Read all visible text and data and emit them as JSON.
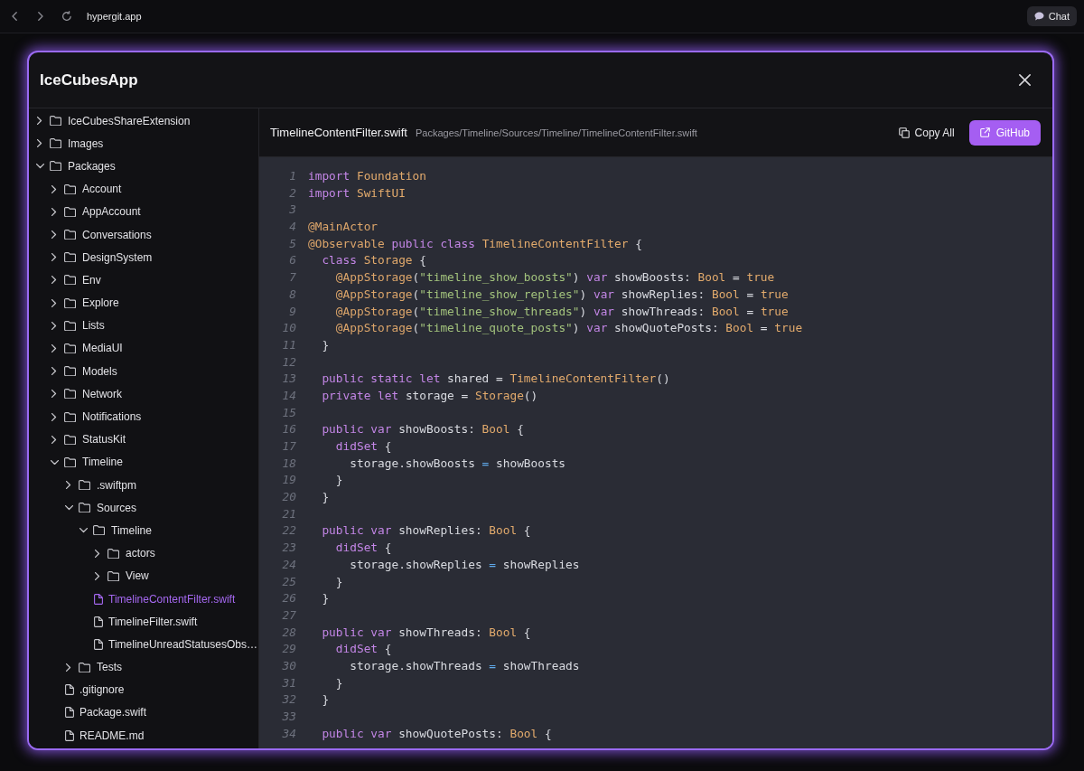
{
  "browser": {
    "url": "hypergit.app",
    "chat_button": "Chat"
  },
  "modal": {
    "title": "IceCubesApp"
  },
  "file_tree": [
    {
      "label": "IceCubesShareExtension",
      "kind": "folder",
      "expanded": false,
      "selected": false
    },
    {
      "label": "Images",
      "kind": "folder",
      "expanded": false,
      "selected": false
    },
    {
      "label": "Packages",
      "kind": "folder",
      "expanded": true,
      "selected": false,
      "children": [
        {
          "label": "Account",
          "kind": "folder",
          "expanded": false,
          "selected": false
        },
        {
          "label": "AppAccount",
          "kind": "folder",
          "expanded": false,
          "selected": false
        },
        {
          "label": "Conversations",
          "kind": "folder",
          "expanded": false,
          "selected": false
        },
        {
          "label": "DesignSystem",
          "kind": "folder",
          "expanded": false,
          "selected": false
        },
        {
          "label": "Env",
          "kind": "folder",
          "expanded": false,
          "selected": false
        },
        {
          "label": "Explore",
          "kind": "folder",
          "expanded": false,
          "selected": false
        },
        {
          "label": "Lists",
          "kind": "folder",
          "expanded": false,
          "selected": false
        },
        {
          "label": "MediaUI",
          "kind": "folder",
          "expanded": false,
          "selected": false
        },
        {
          "label": "Models",
          "kind": "folder",
          "expanded": false,
          "selected": false
        },
        {
          "label": "Network",
          "kind": "folder",
          "expanded": false,
          "selected": false
        },
        {
          "label": "Notifications",
          "kind": "folder",
          "expanded": false,
          "selected": false
        },
        {
          "label": "StatusKit",
          "kind": "folder",
          "expanded": false,
          "selected": false
        },
        {
          "label": "Timeline",
          "kind": "folder",
          "expanded": true,
          "selected": false,
          "children": [
            {
              "label": ".swiftpm",
              "kind": "folder",
              "expanded": false,
              "selected": false
            },
            {
              "label": "Sources",
              "kind": "folder",
              "expanded": true,
              "selected": false,
              "children": [
                {
                  "label": "Timeline",
                  "kind": "folder",
                  "expanded": true,
                  "selected": false,
                  "children": [
                    {
                      "label": "actors",
                      "kind": "folder",
                      "expanded": false,
                      "selected": false
                    },
                    {
                      "label": "View",
                      "kind": "folder",
                      "expanded": false,
                      "selected": false
                    },
                    {
                      "label": "TimelineContentFilter.swift",
                      "kind": "file",
                      "selected": true
                    },
                    {
                      "label": "TimelineFilter.swift",
                      "kind": "file",
                      "selected": false
                    },
                    {
                      "label": "TimelineUnreadStatusesObs…",
                      "kind": "file",
                      "selected": false
                    }
                  ]
                }
              ]
            },
            {
              "label": "Tests",
              "kind": "folder",
              "expanded": false,
              "selected": false
            },
            {
              "label": ".gitignore",
              "kind": "file",
              "selected": false
            },
            {
              "label": "Package.swift",
              "kind": "file",
              "selected": false
            },
            {
              "label": "README.md",
              "kind": "file",
              "selected": false
            }
          ]
        }
      ]
    }
  ],
  "file_header": {
    "name": "TimelineContentFilter.swift",
    "path": "Packages/Timeline/Sources/Timeline/TimelineContentFilter.swift",
    "copy_button": "Copy All",
    "github_button": "GitHub"
  },
  "code": {
    "lines": [
      {
        "number": "1",
        "tokens": [
          {
            "kind": "keyword",
            "text": "import"
          },
          {
            "kind": "type",
            "text": " Foundation"
          }
        ]
      },
      {
        "number": "2",
        "tokens": [
          {
            "kind": "keyword",
            "text": "import"
          },
          {
            "kind": "type",
            "text": " SwiftUI"
          }
        ]
      },
      {
        "number": "3"
      },
      {
        "number": "4",
        "tokens": [
          {
            "kind": "attribute",
            "text": "@MainActor"
          }
        ]
      },
      {
        "number": "5",
        "tokens": [
          {
            "kind": "attribute",
            "text": "@Observable"
          },
          {
            "kind": "keyword",
            "text": " public class"
          },
          {
            "kind": "type",
            "text": " TimelineContentFilter"
          },
          {
            "kind": "plain",
            "text": " {"
          }
        ]
      },
      {
        "number": "6",
        "tokens": [
          {
            "kind": "keyword",
            "text": "  class"
          },
          {
            "kind": "type",
            "text": " Storage"
          },
          {
            "kind": "plain",
            "text": " {"
          }
        ]
      },
      {
        "number": "7",
        "tokens": [
          {
            "kind": "attribute",
            "text": "    @AppStorage"
          },
          {
            "kind": "plain",
            "text": "("
          },
          {
            "kind": "string",
            "text": "\"timeline_show_boosts\""
          },
          {
            "kind": "plain",
            "text": ")"
          },
          {
            "kind": "keyword",
            "text": " var"
          },
          {
            "kind": "plain",
            "text": " showBoosts:"
          },
          {
            "kind": "type",
            "text": " Bool"
          },
          {
            "kind": "plain",
            "text": " ="
          },
          {
            "kind": "literal",
            "text": " true"
          }
        ]
      },
      {
        "number": "8",
        "tokens": [
          {
            "kind": "attribute",
            "text": "    @AppStorage"
          },
          {
            "kind": "plain",
            "text": "("
          },
          {
            "kind": "string",
            "text": "\"timeline_show_replies\""
          },
          {
            "kind": "plain",
            "text": ")"
          },
          {
            "kind": "keyword",
            "text": " var"
          },
          {
            "kind": "plain",
            "text": " showReplies:"
          },
          {
            "kind": "type",
            "text": " Bool"
          },
          {
            "kind": "plain",
            "text": " ="
          },
          {
            "kind": "literal",
            "text": " true"
          }
        ]
      },
      {
        "number": "9",
        "tokens": [
          {
            "kind": "attribute",
            "text": "    @AppStorage"
          },
          {
            "kind": "plain",
            "text": "("
          },
          {
            "kind": "string",
            "text": "\"timeline_show_threads\""
          },
          {
            "kind": "plain",
            "text": ")"
          },
          {
            "kind": "keyword",
            "text": " var"
          },
          {
            "kind": "plain",
            "text": " showThreads:"
          },
          {
            "kind": "type",
            "text": " Bool"
          },
          {
            "kind": "plain",
            "text": " ="
          },
          {
            "kind": "literal",
            "text": " true"
          }
        ]
      },
      {
        "number": "10",
        "tokens": [
          {
            "kind": "attribute",
            "text": "    @AppStorage"
          },
          {
            "kind": "plain",
            "text": "("
          },
          {
            "kind": "string",
            "text": "\"timeline_quote_posts\""
          },
          {
            "kind": "plain",
            "text": ")"
          },
          {
            "kind": "keyword",
            "text": " var"
          },
          {
            "kind": "plain",
            "text": " showQuotePosts:"
          },
          {
            "kind": "type",
            "text": " Bool"
          },
          {
            "kind": "plain",
            "text": " ="
          },
          {
            "kind": "literal",
            "text": " true"
          }
        ]
      },
      {
        "number": "11",
        "tokens": [
          {
            "kind": "plain",
            "text": "  }"
          }
        ]
      },
      {
        "number": "12"
      },
      {
        "number": "13",
        "tokens": [
          {
            "kind": "keyword",
            "text": "  public static let"
          },
          {
            "kind": "plain",
            "text": " shared ="
          },
          {
            "kind": "type",
            "text": " TimelineContentFilter"
          },
          {
            "kind": "plain",
            "text": "()"
          }
        ]
      },
      {
        "number": "14",
        "tokens": [
          {
            "kind": "keyword",
            "text": "  private let"
          },
          {
            "kind": "plain",
            "text": " storage ="
          },
          {
            "kind": "type",
            "text": " Storage"
          },
          {
            "kind": "plain",
            "text": "()"
          }
        ]
      },
      {
        "number": "15"
      },
      {
        "number": "16",
        "tokens": [
          {
            "kind": "keyword",
            "text": "  public var"
          },
          {
            "kind": "plain",
            "text": " showBoosts:"
          },
          {
            "kind": "type",
            "text": " Bool"
          },
          {
            "kind": "plain",
            "text": " {"
          }
        ]
      },
      {
        "number": "17",
        "tokens": [
          {
            "kind": "keyword",
            "text": "    didSet"
          },
          {
            "kind": "plain",
            "text": " {"
          }
        ]
      },
      {
        "number": "18",
        "tokens": [
          {
            "kind": "plain",
            "text": "      storage.showBoosts"
          },
          {
            "kind": "operator",
            "text": " ="
          },
          {
            "kind": "plain",
            "text": " showBoosts"
          }
        ]
      },
      {
        "number": "19",
        "tokens": [
          {
            "kind": "plain",
            "text": "    }"
          }
        ]
      },
      {
        "number": "20",
        "tokens": [
          {
            "kind": "plain",
            "text": "  }"
          }
        ]
      },
      {
        "number": "21"
      },
      {
        "number": "22",
        "tokens": [
          {
            "kind": "keyword",
            "text": "  public var"
          },
          {
            "kind": "plain",
            "text": " showReplies:"
          },
          {
            "kind": "type",
            "text": " Bool"
          },
          {
            "kind": "plain",
            "text": " {"
          }
        ]
      },
      {
        "number": "23",
        "tokens": [
          {
            "kind": "keyword",
            "text": "    didSet"
          },
          {
            "kind": "plain",
            "text": " {"
          }
        ]
      },
      {
        "number": "24",
        "tokens": [
          {
            "kind": "plain",
            "text": "      storage.showReplies"
          },
          {
            "kind": "operator",
            "text": " ="
          },
          {
            "kind": "plain",
            "text": " showReplies"
          }
        ]
      },
      {
        "number": "25",
        "tokens": [
          {
            "kind": "plain",
            "text": "    }"
          }
        ]
      },
      {
        "number": "26",
        "tokens": [
          {
            "kind": "plain",
            "text": "  }"
          }
        ]
      },
      {
        "number": "27"
      },
      {
        "number": "28",
        "tokens": [
          {
            "kind": "keyword",
            "text": "  public var"
          },
          {
            "kind": "plain",
            "text": " showThreads:"
          },
          {
            "kind": "type",
            "text": " Bool"
          },
          {
            "kind": "plain",
            "text": " {"
          }
        ]
      },
      {
        "number": "29",
        "tokens": [
          {
            "kind": "keyword",
            "text": "    didSet"
          },
          {
            "kind": "plain",
            "text": " {"
          }
        ]
      },
      {
        "number": "30",
        "tokens": [
          {
            "kind": "plain",
            "text": "      storage.showThreads"
          },
          {
            "kind": "operator",
            "text": " ="
          },
          {
            "kind": "plain",
            "text": " showThreads"
          }
        ]
      },
      {
        "number": "31",
        "tokens": [
          {
            "kind": "plain",
            "text": "    }"
          }
        ]
      },
      {
        "number": "32",
        "tokens": [
          {
            "kind": "plain",
            "text": "  }"
          }
        ]
      },
      {
        "number": "33"
      },
      {
        "number": "34",
        "tokens": [
          {
            "kind": "keyword",
            "text": "  public var"
          },
          {
            "kind": "plain",
            "text": " showQuotePosts:"
          },
          {
            "kind": "type",
            "text": " Bool"
          },
          {
            "kind": "plain",
            "text": " {"
          }
        ]
      }
    ]
  }
}
